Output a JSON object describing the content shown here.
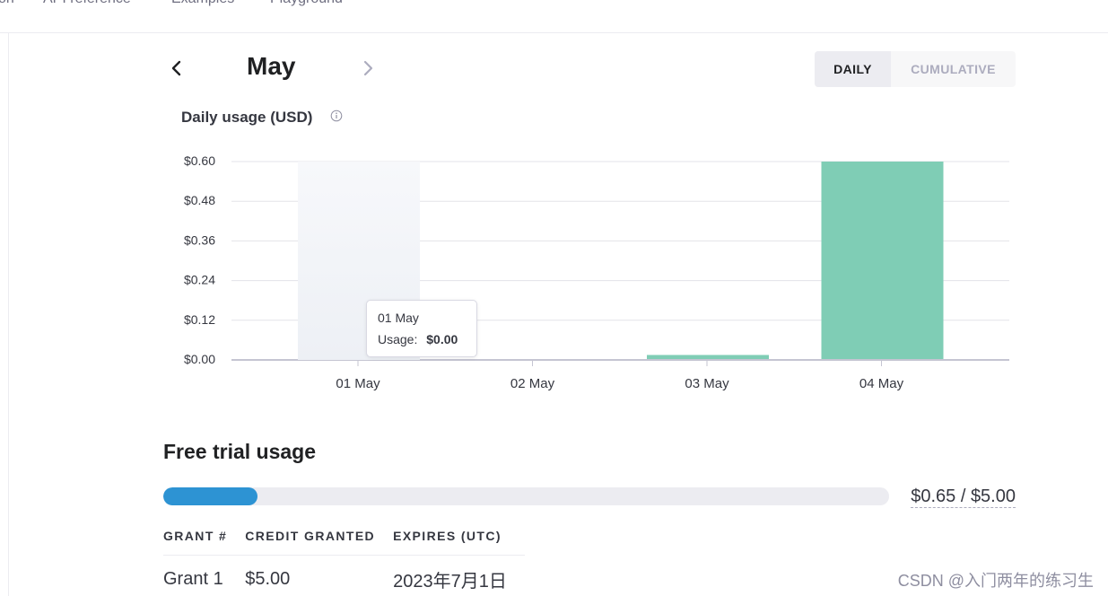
{
  "nav": {
    "items": [
      "on",
      "API reference",
      "Examples",
      "Playground"
    ]
  },
  "month": {
    "title": "May"
  },
  "view_toggle": {
    "daily": "DAILY",
    "cumulative": "CUMULATIVE"
  },
  "chart_data": {
    "type": "bar",
    "title": "Daily usage (USD)",
    "categories": [
      "01 May",
      "02 May",
      "03 May",
      "04 May"
    ],
    "values": [
      0.0,
      0.0,
      0.015,
      0.6
    ],
    "y_ticks": [
      "$0.00",
      "$0.12",
      "$0.24",
      "$0.36",
      "$0.48",
      "$0.60"
    ],
    "ylim": [
      0,
      0.6
    ],
    "grid": true,
    "bar_color": "#7fcdb5",
    "hover_index": 0,
    "tooltip": {
      "date": "01 May",
      "label": "Usage:",
      "value": "$0.00"
    }
  },
  "free_trial": {
    "title": "Free trial usage",
    "used": 0.65,
    "total": 5.0,
    "label": "$0.65 / $5.00",
    "bar_color": "#2d93d3"
  },
  "grants": {
    "headers": [
      "GRANT #",
      "CREDIT GRANTED",
      "EXPIRES (UTC)"
    ],
    "rows": [
      [
        "Grant 1",
        "$5.00",
        "2023年7月1日"
      ]
    ]
  },
  "watermark": "CSDN @入门两年的练习生"
}
